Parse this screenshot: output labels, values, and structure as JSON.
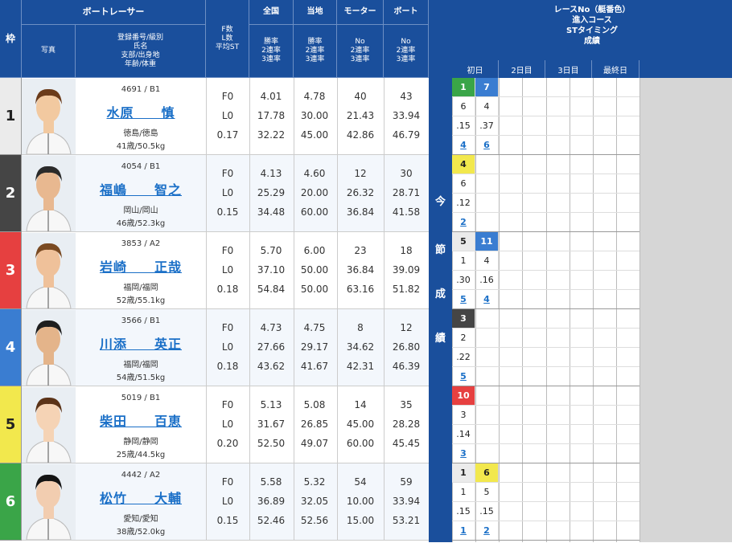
{
  "header": {
    "waku": "枠",
    "racer": "ボートレーサー",
    "photo": "写真",
    "info": [
      "登録番号/級別",
      "氏名",
      "支部/出身地",
      "年齢/体重"
    ],
    "fl": [
      "F数",
      "L数",
      "平均ST"
    ],
    "zenkoku": "全国",
    "touchi": "当地",
    "motor": "モーター",
    "boat": "ボート",
    "rate3": [
      "勝率",
      "2連率",
      "3連率"
    ],
    "no3": [
      "No",
      "2連率",
      "3連率"
    ]
  },
  "right_header": {
    "lines": [
      "レースNo（艇番色）",
      "進入コース",
      "STタイミング",
      "成績"
    ],
    "days": [
      "初日",
      "2日目",
      "3日目",
      "最終日"
    ]
  },
  "vertical_label": [
    "今",
    "節",
    "成",
    "績"
  ],
  "waku_colors": [
    "#ebebeb",
    "#454545",
    "#e64040",
    "#3a7dd1",
    "#f2e84d",
    "#3aa548"
  ],
  "racers": [
    {
      "waku": "1",
      "reg": "4691 / B1",
      "name": "水原　　慎",
      "branch": "徳島/徳島",
      "age": "41歳/50.5kg",
      "f": "F0",
      "l": "L0",
      "st": "0.17",
      "zen": [
        "4.01",
        "17.78",
        "32.22"
      ],
      "tou": [
        "4.78",
        "30.00",
        "45.00"
      ],
      "mot": [
        "40",
        "21.43",
        "42.86"
      ],
      "boat": [
        "43",
        "33.94",
        "46.79"
      ],
      "races": [
        {
          "no": "1",
          "color": "#3aa548",
          "text": "#fff",
          "course": "6",
          "st": ".15",
          "rank": "4"
        },
        {
          "no": "7",
          "color": "#3a7dd1",
          "text": "#fff",
          "course": "4",
          "st": ".37",
          "rank": "6"
        }
      ]
    },
    {
      "waku": "2",
      "reg": "4054 / B1",
      "name": "福嶋　　智之",
      "branch": "岡山/岡山",
      "age": "46歳/52.3kg",
      "f": "F0",
      "l": "L0",
      "st": "0.15",
      "zen": [
        "4.13",
        "25.29",
        "34.48"
      ],
      "tou": [
        "4.60",
        "20.00",
        "60.00"
      ],
      "mot": [
        "12",
        "26.32",
        "36.84"
      ],
      "boat": [
        "30",
        "28.71",
        "41.58"
      ],
      "races": [
        {
          "no": "4",
          "color": "#f2e84d",
          "text": "#222",
          "course": "6",
          "st": ".12",
          "rank": "2"
        }
      ]
    },
    {
      "waku": "3",
      "reg": "3853 / A2",
      "name": "岩崎　　正哉",
      "branch": "福岡/福岡",
      "age": "52歳/55.1kg",
      "f": "F0",
      "l": "L0",
      "st": "0.18",
      "zen": [
        "5.70",
        "37.10",
        "54.84"
      ],
      "tou": [
        "6.00",
        "50.00",
        "50.00"
      ],
      "mot": [
        "23",
        "36.84",
        "63.16"
      ],
      "boat": [
        "18",
        "39.09",
        "51.82"
      ],
      "races": [
        {
          "no": "5",
          "color": "#ebebeb",
          "text": "#222",
          "course": "1",
          "st": ".30",
          "rank": "5"
        },
        {
          "no": "11",
          "color": "#3a7dd1",
          "text": "#fff",
          "course": "4",
          "st": ".16",
          "rank": "4"
        }
      ]
    },
    {
      "waku": "4",
      "reg": "3566 / B1",
      "name": "川添　　英正",
      "branch": "福岡/福岡",
      "age": "54歳/51.5kg",
      "f": "F0",
      "l": "L0",
      "st": "0.18",
      "zen": [
        "4.73",
        "27.66",
        "43.62"
      ],
      "tou": [
        "4.75",
        "29.17",
        "41.67"
      ],
      "mot": [
        "8",
        "34.62",
        "42.31"
      ],
      "boat": [
        "12",
        "26.80",
        "46.39"
      ],
      "races": [
        {
          "no": "3",
          "color": "#454545",
          "text": "#fff",
          "course": "2",
          "st": ".22",
          "rank": "5"
        }
      ]
    },
    {
      "waku": "5",
      "reg": "5019 / B1",
      "name": "柴田　　百恵",
      "branch": "静岡/静岡",
      "age": "25歳/44.5kg",
      "f": "F0",
      "l": "L0",
      "st": "0.20",
      "zen": [
        "5.13",
        "31.67",
        "52.50"
      ],
      "tou": [
        "5.08",
        "26.85",
        "49.07"
      ],
      "mot": [
        "14",
        "45.00",
        "60.00"
      ],
      "boat": [
        "35",
        "28.28",
        "45.45"
      ],
      "races": [
        {
          "no": "10",
          "color": "#e64040",
          "text": "#fff",
          "course": "3",
          "st": ".14",
          "rank": "3"
        }
      ]
    },
    {
      "waku": "6",
      "reg": "4442 / A2",
      "name": "松竹　　大輔",
      "branch": "愛知/愛知",
      "age": "38歳/52.0kg",
      "f": "F0",
      "l": "L0",
      "st": "0.15",
      "zen": [
        "5.58",
        "36.89",
        "52.46"
      ],
      "tou": [
        "5.32",
        "32.05",
        "52.56"
      ],
      "mot": [
        "54",
        "10.00",
        "15.00"
      ],
      "boat": [
        "59",
        "33.94",
        "53.21"
      ],
      "races": [
        {
          "no": "1",
          "color": "#ebebeb",
          "text": "#222",
          "course": "1",
          "st": ".15",
          "rank": "1"
        },
        {
          "no": "6",
          "color": "#f2e84d",
          "text": "#222",
          "course": "5",
          "st": ".15",
          "rank": "2"
        }
      ]
    }
  ]
}
